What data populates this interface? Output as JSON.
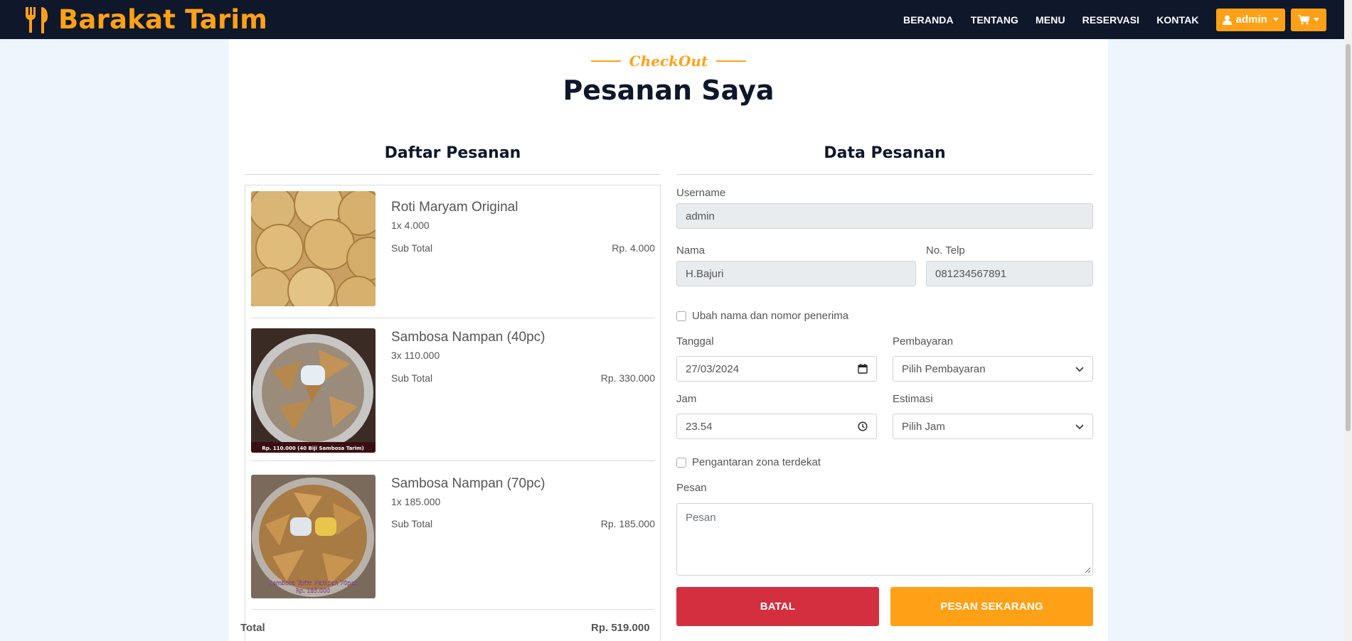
{
  "navbar": {
    "brand": "Barakat Tarim",
    "links": [
      "BERANDA",
      "TENTANG",
      "MENU",
      "RESERVASI",
      "KONTAK"
    ],
    "user_label": "admin"
  },
  "page": {
    "subtitle": "CheckOut",
    "title": "Pesanan Saya"
  },
  "order_list": {
    "title": "Daftar Pesanan",
    "items": [
      {
        "name": "Roti Maryam Original",
        "qty": "1x 4.000",
        "subtotal_label": "Sub Total",
        "subtotal": "Rp. 4.000"
      },
      {
        "name": "Sambosa Nampan (40pc)",
        "qty": "3x 110.000",
        "subtotal_label": "Sub Total",
        "subtotal": "Rp. 330.000",
        "image_caption": "Rp. 110.000 (40 Biji Sambosa Tarim)"
      },
      {
        "name": "Sambosa Nampan (70pc)",
        "qty": "1x 185.000",
        "subtotal_label": "Sub Total",
        "subtotal": "Rp. 185.000",
        "image_caption_1": "Sambosa Tarim Nampan 70pcs",
        "image_caption_2": "Rp. 185.000"
      }
    ],
    "total_label": "Total",
    "total": "Rp. 519.000"
  },
  "form": {
    "title": "Data Pesanan",
    "username_label": "Username",
    "username": "admin",
    "name_label": "Nama",
    "name": "H.Bajuri",
    "phone_label": "No. Telp",
    "phone": "081234567891",
    "change_recipient": "Ubah nama dan nomor penerima",
    "date_label": "Tanggal",
    "date": "27/03/2024",
    "payment_label": "Pembayaran",
    "payment": "Pilih Pembayaran",
    "time_label": "Jam",
    "time": "23.54",
    "estimate_label": "Estimasi",
    "estimate": "Pilih Jam",
    "delivery": "Pengantaran zona terdekat",
    "message_label": "Pesan",
    "message_placeholder": "Pesan",
    "cancel": "BATAL",
    "order_now": "PESAN SEKARANG"
  },
  "colors": {
    "primary": "#fea116",
    "dark": "#0f172b",
    "danger": "#d42f3f",
    "page_bg": "#eef6fd"
  }
}
